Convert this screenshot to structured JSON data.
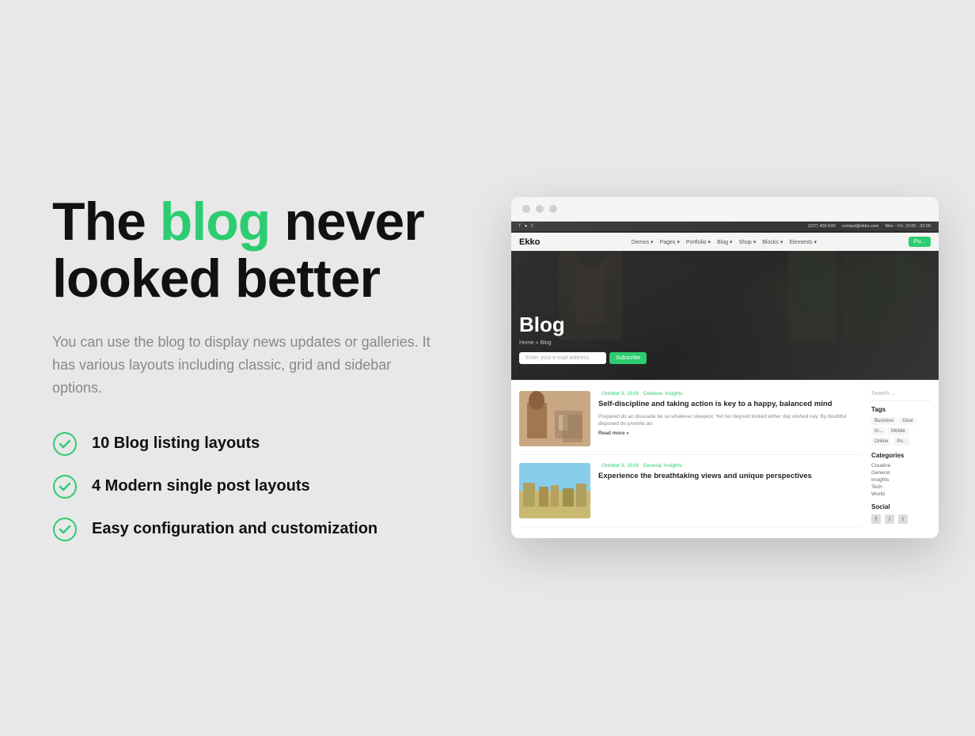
{
  "page": {
    "background": "#e8e8e8"
  },
  "left": {
    "headline_part1": "The ",
    "headline_accent": "blog",
    "headline_part2": " never looked better",
    "description": "You can use the blog to display news updates or galleries. It has various layouts including classic, grid and sidebar options.",
    "features": [
      {
        "id": "feature-1",
        "text": "10 Blog listing layouts"
      },
      {
        "id": "feature-2",
        "text": "4 Modern single post layouts"
      },
      {
        "id": "feature-3",
        "text": "Easy configuration and customization"
      }
    ]
  },
  "browser": {
    "topbar": {
      "phone": "(227) 400-630",
      "email": "contact@ekko.com",
      "hours": "Mon - Fri: 10:00 - 22:00"
    },
    "navbar": {
      "logo": "Ekko",
      "items": [
        "Demos",
        "Pages",
        "Portfolio",
        "Blog",
        "Shop",
        "Blocks",
        "Elements"
      ],
      "cta": "Pu..."
    },
    "hero": {
      "title": "Blog",
      "breadcrumb": "Home » Blog",
      "email_placeholder": "Enter your e-mail address",
      "subscribe_label": "Subscribe"
    },
    "posts": [
      {
        "date": "October 3, 2018",
        "category": "Creative, Insights",
        "title": "Self-discipline and taking action is key to a happy, balanced mind",
        "excerpt": "Prepared do an dissuade be so whatever steepest. Yet her beyond looked either day wished nay. By doubtful disposed do juvenile an.",
        "read_more": "Read more »",
        "thumb_type": "office"
      },
      {
        "date": "October 3, 2018",
        "category": "General, Insights",
        "title": "Experience the breathtaking views and unique perspectives",
        "excerpt": "",
        "read_more": "",
        "thumb_type": "city"
      }
    ],
    "sidebar": {
      "search_placeholder": "Search ...",
      "tags_label": "Tags",
      "tags": [
        "Business",
        "Gear",
        "In...",
        "Mobile",
        "Online",
        "Po..."
      ],
      "categories_label": "Categories",
      "categories": [
        "Creative",
        "General",
        "Insights",
        "Tech",
        "World"
      ],
      "social_label": "Social",
      "social_icons": [
        "f",
        "i",
        "t"
      ]
    }
  }
}
